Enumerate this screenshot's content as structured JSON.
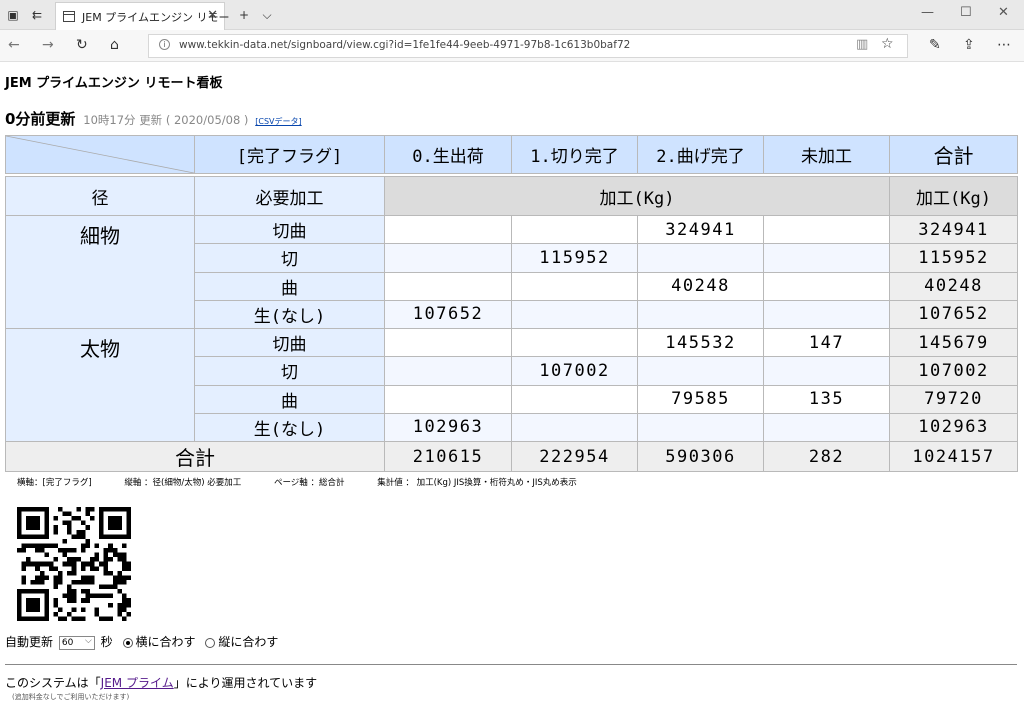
{
  "browser": {
    "tab_title": "JEM プライムエンジン リモー",
    "url": "www.tekkin-data.net/signboard/view.cgi?id=1fe1fe44-9eeb-4971-97b8-1c613b0baf72"
  },
  "page": {
    "title": "JEM プライムエンジン リモート看板",
    "update_main": "0分前更新",
    "update_time": "10時17分 更新 ( 2020/05/08 )",
    "csv_link": "[CSVデータ]"
  },
  "table": {
    "flag_header": "[完了フラグ]",
    "col_headers": [
      "0.生出荷",
      "1.切り完了",
      "2.曲げ完了",
      "未加工"
    ],
    "total_header": "合計",
    "size_header": "径",
    "process_header": "必要加工",
    "unit_header": "加工(Kg)",
    "unit_total_header": "加工(Kg)",
    "groups": [
      {
        "name": "細物",
        "rows": [
          {
            "process": "切曲",
            "values": [
              "",
              "",
              "324941",
              ""
            ],
            "total": "324941"
          },
          {
            "process": "切",
            "values": [
              "",
              "115952",
              "",
              ""
            ],
            "total": "115952"
          },
          {
            "process": "曲",
            "values": [
              "",
              "",
              "40248",
              ""
            ],
            "total": "40248"
          },
          {
            "process": "生(なし)",
            "values": [
              "107652",
              "",
              "",
              ""
            ],
            "total": "107652"
          }
        ]
      },
      {
        "name": "太物",
        "rows": [
          {
            "process": "切曲",
            "values": [
              "",
              "",
              "145532",
              "147"
            ],
            "total": "145679"
          },
          {
            "process": "切",
            "values": [
              "",
              "107002",
              "",
              ""
            ],
            "total": "107002"
          },
          {
            "process": "曲",
            "values": [
              "",
              "",
              "79585",
              "135"
            ],
            "total": "79720"
          },
          {
            "process": "生(なし)",
            "values": [
              "102963",
              "",
              "",
              ""
            ],
            "total": "102963"
          }
        ]
      }
    ],
    "grand_total_label": "合計",
    "grand_totals": [
      "210615",
      "222954",
      "590306",
      "282"
    ],
    "grand_total_all": "1024157"
  },
  "legend": {
    "horizontal": "横軸：[完了フラグ]",
    "vertical": "縦軸 ：径(細物/太物) 必要加工",
    "page_axis": "ページ軸 ：総合計",
    "aggregate": "集計値 ： 加工(Kg) JIS換算・桁符丸め・JIS丸め表示"
  },
  "controls": {
    "auto_refresh_label": "自動更新",
    "refresh_value": "60",
    "seconds_label": "秒",
    "fit_width": "横に合わす",
    "fit_height": "縦に合わす"
  },
  "footer": {
    "prefix": "このシステムは「",
    "link": "JEM プライム",
    "suffix": "」により運用されています",
    "note": "(追加料金なしでご利用いただけます)"
  }
}
